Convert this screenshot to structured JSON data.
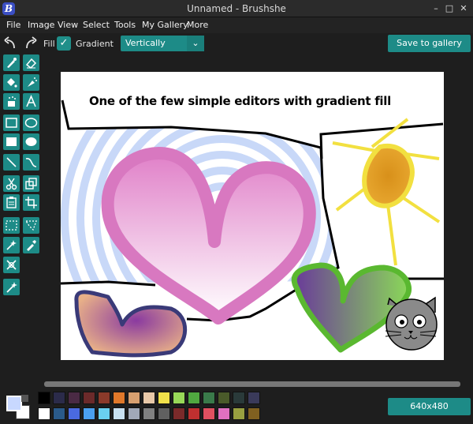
{
  "window": {
    "title": "Unnamed - Brushshe",
    "logo": "B",
    "minimize_icon": "–",
    "maximize_icon": "□",
    "close_icon": "✕"
  },
  "menu": [
    "File",
    "Image",
    "View",
    "Select",
    "Tools",
    "My Gallery",
    "More"
  ],
  "toolbar": {
    "fill_label": "Fill",
    "gradient_label": "Gradient",
    "gradient_checked": true,
    "direction_value": "Vertically",
    "save_label": "Save to gallery"
  },
  "canvas": {
    "text": "One of the few simple editors with gradient fill",
    "size_label": "640x480"
  },
  "tools": [
    "brush-icon",
    "eraser-icon",
    "fill-bucket-icon",
    "spray-icon",
    "noise-icon",
    "text-icon",
    "rectangle-icon",
    "oval-icon",
    "filled-rectangle-icon",
    "filled-oval-icon",
    "line-icon",
    "curve-icon",
    "scissors-icon",
    "copy-icon",
    "paste-icon",
    "crop-icon",
    "select-rect-icon",
    "select-lasso-icon",
    "effects-icon",
    "eyedropper-icon",
    "remove-white-icon",
    "magic-wand-icon"
  ],
  "colors": {
    "accent": "#1d8b87",
    "palette_row1": [
      "#000000",
      "#2b2b4a",
      "#4a2a44",
      "#6b2a2a",
      "#8b3a2a",
      "#e0782a",
      "#d8a070",
      "#e8c8a8",
      "#f0e04a",
      "#98d858",
      "#50a840",
      "#3a7a4a",
      "#4a5a2a",
      "#2a3a3a",
      "#3a3a5a"
    ],
    "palette_row2": [
      "#ffffff",
      "#2a5a8a",
      "#4a6ae0",
      "#4aa0f0",
      "#6ad0f0",
      "#c8e0f0",
      "#a0a8b8",
      "#808080",
      "#606060",
      "#7a2a2a",
      "#c03030",
      "#e05060",
      "#e070c0",
      "#98a040",
      "#806020"
    ],
    "foreground": "#c8d8ff",
    "background": "#ffffff"
  }
}
